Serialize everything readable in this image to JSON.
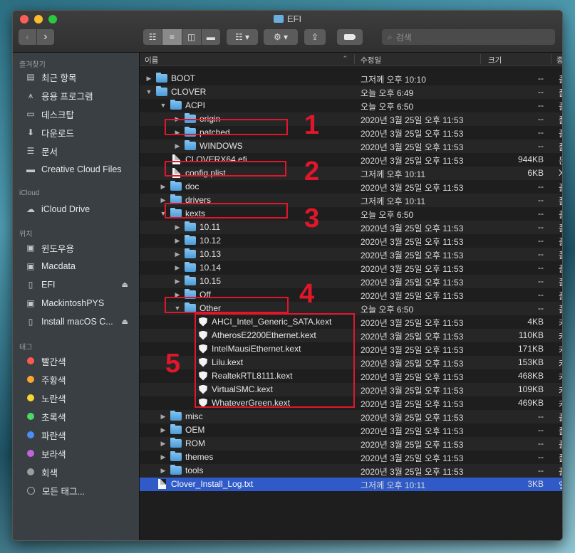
{
  "window": {
    "title": "EFI"
  },
  "toolbar": {
    "search_placeholder": "검색"
  },
  "sidebar": {
    "favorites_header": "즐겨찾기",
    "favorites": [
      {
        "label": "최근 항목",
        "icon": "recent-icon"
      },
      {
        "label": "응용 프로그램",
        "icon": "applications-icon"
      },
      {
        "label": "데스크탑",
        "icon": "desktop-icon"
      },
      {
        "label": "다운로드",
        "icon": "download-icon"
      },
      {
        "label": "문서",
        "icon": "documents-icon"
      },
      {
        "label": "Creative Cloud Files",
        "icon": "folder-icon"
      }
    ],
    "icloud_header": "iCloud",
    "icloud": [
      {
        "label": "iCloud Drive",
        "icon": "cloud-icon"
      }
    ],
    "locations_header": "위치",
    "locations": [
      {
        "label": "윈도우용",
        "icon": "disk-icon"
      },
      {
        "label": "Macdata",
        "icon": "disk-icon"
      },
      {
        "label": "EFI",
        "icon": "disk-icon"
      },
      {
        "label": "MackintoshPYS",
        "icon": "disk-icon"
      },
      {
        "label": "Install macOS C...",
        "icon": "disk-icon"
      }
    ],
    "tags_header": "태그",
    "tags": [
      {
        "label": "빨간색",
        "color": "#ff5a52"
      },
      {
        "label": "주황색",
        "color": "#fda52f"
      },
      {
        "label": "노란색",
        "color": "#f7d631"
      },
      {
        "label": "초록색",
        "color": "#4cd964"
      },
      {
        "label": "파란색",
        "color": "#4c8df6"
      },
      {
        "label": "보라색",
        "color": "#c462dd"
      },
      {
        "label": "회색",
        "color": "#9d9d9d"
      },
      {
        "label": "모든 태그..."
      }
    ]
  },
  "columns": {
    "name": "이름",
    "modified": "수정일",
    "size": "크기",
    "kind": "종"
  },
  "rows": [
    {
      "name": "BOOT",
      "date": "그저께 오후 10:10",
      "size": "--",
      "kind": "폴"
    },
    {
      "name": "CLOVER",
      "date": "오늘 오후 6:49",
      "size": "--",
      "kind": "폴"
    },
    {
      "name": "ACPI",
      "date": "오늘 오후 6:50",
      "size": "--",
      "kind": "폴"
    },
    {
      "name": "origin",
      "date": "2020년 3월 25일 오후 11:53",
      "size": "--",
      "kind": "폴"
    },
    {
      "name": "patched",
      "date": "2020년 3월 25일 오후 11:53",
      "size": "--",
      "kind": "폴"
    },
    {
      "name": "WINDOWS",
      "date": "2020년 3월 25일 오후 11:53",
      "size": "--",
      "kind": "폴"
    },
    {
      "name": "CLOVERX64.efi",
      "date": "2020년 3월 25일 오후 11:53",
      "size": "944KB",
      "kind": "문"
    },
    {
      "name": "config.plist",
      "date": "그저께 오후 10:11",
      "size": "6KB",
      "kind": "X"
    },
    {
      "name": "doc",
      "date": "2020년 3월 25일 오후 11:53",
      "size": "--",
      "kind": "폴"
    },
    {
      "name": "drivers",
      "date": "그저께 오후 10:11",
      "size": "--",
      "kind": "폴"
    },
    {
      "name": "kexts",
      "date": "오늘 오후 6:50",
      "size": "--",
      "kind": "폴"
    },
    {
      "name": "10.11",
      "date": "2020년 3월 25일 오후 11:53",
      "size": "--",
      "kind": "폴"
    },
    {
      "name": "10.12",
      "date": "2020년 3월 25일 오후 11:53",
      "size": "--",
      "kind": "폴"
    },
    {
      "name": "10.13",
      "date": "2020년 3월 25일 오후 11:53",
      "size": "--",
      "kind": "폴"
    },
    {
      "name": "10.14",
      "date": "2020년 3월 25일 오후 11:53",
      "size": "--",
      "kind": "폴"
    },
    {
      "name": "10.15",
      "date": "2020년 3월 25일 오후 11:53",
      "size": "--",
      "kind": "폴"
    },
    {
      "name": "Off",
      "date": "2020년 3월 25일 오후 11:53",
      "size": "--",
      "kind": "폴"
    },
    {
      "name": "Other",
      "date": "오늘 오후 6:50",
      "size": "--",
      "kind": "폴"
    },
    {
      "name": "AHCI_Intel_Generic_SATA.kext",
      "date": "2020년 3월 25일 오후 11:53",
      "size": "4KB",
      "kind": "커"
    },
    {
      "name": "AtherosE2200Ethernet.kext",
      "date": "2020년 3월 25일 오후 11:53",
      "size": "110KB",
      "kind": "커"
    },
    {
      "name": "IntelMausiEthernet.kext",
      "date": "2020년 3월 25일 오후 11:53",
      "size": "171KB",
      "kind": "커"
    },
    {
      "name": "Lilu.kext",
      "date": "2020년 3월 25일 오후 11:53",
      "size": "153KB",
      "kind": "커"
    },
    {
      "name": "RealtekRTL8111.kext",
      "date": "2020년 3월 25일 오후 11:53",
      "size": "468KB",
      "kind": "커"
    },
    {
      "name": "VirtualSMC.kext",
      "date": "2020년 3월 25일 오후 11:53",
      "size": "109KB",
      "kind": "커"
    },
    {
      "name": "WhateverGreen.kext",
      "date": "2020년 3월 25일 오후 11:53",
      "size": "469KB",
      "kind": "커"
    },
    {
      "name": "misc",
      "date": "2020년 3월 25일 오후 11:53",
      "size": "--",
      "kind": "폴"
    },
    {
      "name": "OEM",
      "date": "2020년 3월 25일 오후 11:53",
      "size": "--",
      "kind": "폴"
    },
    {
      "name": "ROM",
      "date": "2020년 3월 25일 오후 11:53",
      "size": "--",
      "kind": "폴"
    },
    {
      "name": "themes",
      "date": "2020년 3월 25일 오후 11:53",
      "size": "--",
      "kind": "폴"
    },
    {
      "name": "tools",
      "date": "2020년 3월 25일 오후 11:53",
      "size": "--",
      "kind": "폴"
    },
    {
      "name": "Clover_Install_Log.txt",
      "date": "그저께 오후 10:11",
      "size": "3KB",
      "kind": "일"
    }
  ],
  "annotations": [
    "1",
    "2",
    "3",
    "4",
    "5"
  ],
  "colors": {
    "annotation": "#e2162b",
    "selection": "#2f5ac7",
    "folder": "#5aa9e2"
  }
}
